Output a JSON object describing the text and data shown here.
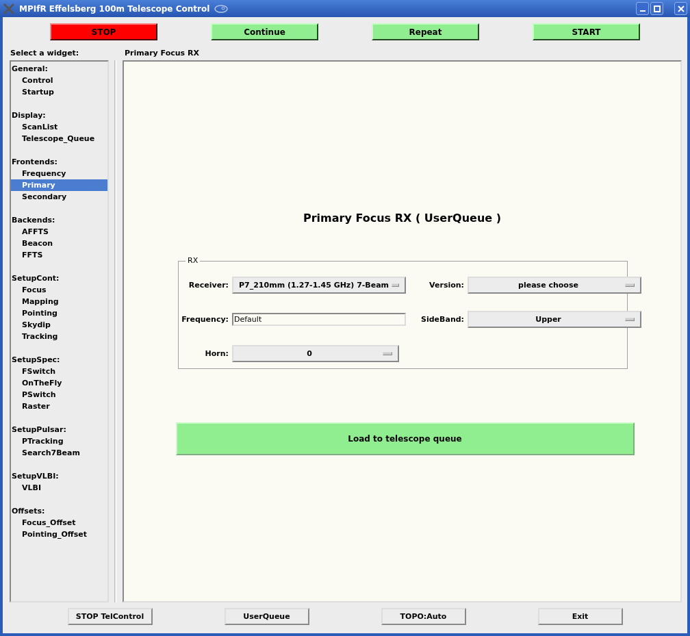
{
  "window": {
    "title": "MPIfR Effelsberg 100m Telescope Control"
  },
  "top_buttons": [
    {
      "label": "STOP",
      "kind": "danger"
    },
    {
      "label": "Continue",
      "kind": "go"
    },
    {
      "label": "Repeat",
      "kind": "go"
    },
    {
      "label": "START",
      "kind": "go"
    }
  ],
  "sidebar": {
    "title": "Select a widget:",
    "groups": [
      {
        "label": "General:",
        "children": [
          {
            "label": "Control",
            "selected": false
          },
          {
            "label": "Startup",
            "selected": false
          }
        ]
      },
      {
        "label": "Display:",
        "children": [
          {
            "label": "ScanList",
            "selected": false
          },
          {
            "label": "Telescope_Queue",
            "selected": false
          }
        ]
      },
      {
        "label": "Frontends:",
        "children": [
          {
            "label": "Frequency",
            "selected": false
          },
          {
            "label": "Primary",
            "selected": true
          },
          {
            "label": "Secondary",
            "selected": false
          }
        ]
      },
      {
        "label": "Backends:",
        "children": [
          {
            "label": "AFFTS",
            "selected": false
          },
          {
            "label": "Beacon",
            "selected": false
          },
          {
            "label": "FFTS",
            "selected": false
          }
        ]
      },
      {
        "label": "SetupCont:",
        "children": [
          {
            "label": "Focus",
            "selected": false
          },
          {
            "label": "Mapping",
            "selected": false
          },
          {
            "label": "Pointing",
            "selected": false
          },
          {
            "label": "Skydip",
            "selected": false
          },
          {
            "label": "Tracking",
            "selected": false
          }
        ]
      },
      {
        "label": "SetupSpec:",
        "children": [
          {
            "label": "FSwitch",
            "selected": false
          },
          {
            "label": "OnTheFly",
            "selected": false
          },
          {
            "label": "PSwitch",
            "selected": false
          },
          {
            "label": "Raster",
            "selected": false
          }
        ]
      },
      {
        "label": "SetupPulsar:",
        "children": [
          {
            "label": "PTracking",
            "selected": false
          },
          {
            "label": "Search7Beam",
            "selected": false
          }
        ]
      },
      {
        "label": "SetupVLBI:",
        "children": [
          {
            "label": "VLBI",
            "selected": false
          }
        ]
      },
      {
        "label": "Offsets:",
        "children": [
          {
            "label": "Focus_Offset",
            "selected": false
          },
          {
            "label": "Pointing_Offset",
            "selected": false
          }
        ]
      }
    ]
  },
  "panel": {
    "tab_title": "Primary Focus RX",
    "heading": "Primary Focus RX ( UserQueue )",
    "rx": {
      "legend": "RX",
      "fields": [
        {
          "label": "Receiver:",
          "value": "P7_210mm (1.27-1.45 GHz) 7-Beam",
          "kind": "dropdown"
        },
        {
          "label": "Version:",
          "value": "please choose",
          "kind": "dropdown"
        },
        {
          "label": "Frequency:",
          "value": "Default",
          "kind": "text"
        },
        {
          "label": "SideBand:",
          "value": "Upper",
          "kind": "dropdown"
        },
        {
          "label": "Horn:",
          "value": "0",
          "kind": "dropdown"
        }
      ]
    },
    "load_button": "Load to telescope queue"
  },
  "bottom_buttons": [
    "STOP TelControl",
    "UserQueue",
    "TOPO:Auto",
    "Exit"
  ]
}
